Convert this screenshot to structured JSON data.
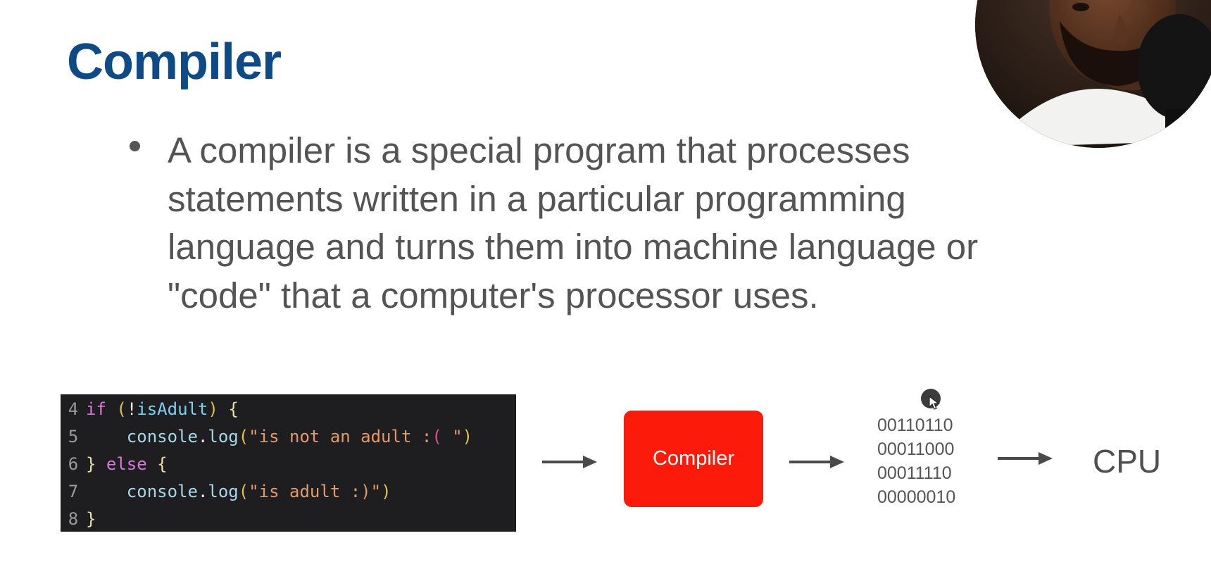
{
  "slide": {
    "title": "Compiler",
    "bullet_lines": [
      "A compiler is a special program that processes",
      "statements written in a particular programming",
      "language and turns them into machine language or",
      "\"code\" that a computer's processor uses."
    ]
  },
  "code": {
    "lines": [
      {
        "num": "4",
        "segments": [
          {
            "t": "if",
            "c": "kw"
          },
          {
            "t": " ",
            "c": "plain"
          },
          {
            "t": "(",
            "c": "paren"
          },
          {
            "t": "!",
            "c": "plain"
          },
          {
            "t": "isAdult",
            "c": "ident"
          },
          {
            "t": ")",
            "c": "paren"
          },
          {
            "t": " {",
            "c": "brace"
          }
        ]
      },
      {
        "num": "5",
        "segments": [
          {
            "t": "    ",
            "c": "plain"
          },
          {
            "t": "console",
            "c": "fn"
          },
          {
            "t": ".",
            "c": "plain"
          },
          {
            "t": "log",
            "c": "fn"
          },
          {
            "t": "(",
            "c": "paren"
          },
          {
            "t": "\"is not an adult :",
            "c": "str"
          },
          {
            "t": "( ",
            "c": "sad"
          },
          {
            "t": "\"",
            "c": "str"
          },
          {
            "t": ")",
            "c": "paren"
          }
        ]
      },
      {
        "num": "6",
        "segments": [
          {
            "t": "}",
            "c": "brace"
          },
          {
            "t": " ",
            "c": "plain"
          },
          {
            "t": "else",
            "c": "kw"
          },
          {
            "t": " {",
            "c": "brace"
          }
        ]
      },
      {
        "num": "7",
        "segments": [
          {
            "t": "    ",
            "c": "plain"
          },
          {
            "t": "console",
            "c": "fn"
          },
          {
            "t": ".",
            "c": "plain"
          },
          {
            "t": "log",
            "c": "fn"
          },
          {
            "t": "(",
            "c": "paren"
          },
          {
            "t": "\"is adult :)\"",
            "c": "str"
          },
          {
            "t": ")",
            "c": "paren"
          }
        ]
      },
      {
        "num": "8",
        "segments": [
          {
            "t": "}",
            "c": "brace"
          }
        ]
      }
    ]
  },
  "diagram": {
    "compiler_label": "Compiler",
    "binary_lines": [
      "00110110",
      "00011000",
      "00011110",
      "00000010"
    ],
    "cpu_label": "CPU"
  },
  "colors": {
    "title": "#0e4a86",
    "compiler_box": "#fc1b0a",
    "code_bg": "#1e1e20",
    "body_text": "#545454"
  },
  "icons": {
    "bullet": "bullet-dot-icon",
    "arrow": "arrow-right-icon",
    "cursor": "mouse-cursor-icon",
    "webcam": "presenter-webcam"
  }
}
